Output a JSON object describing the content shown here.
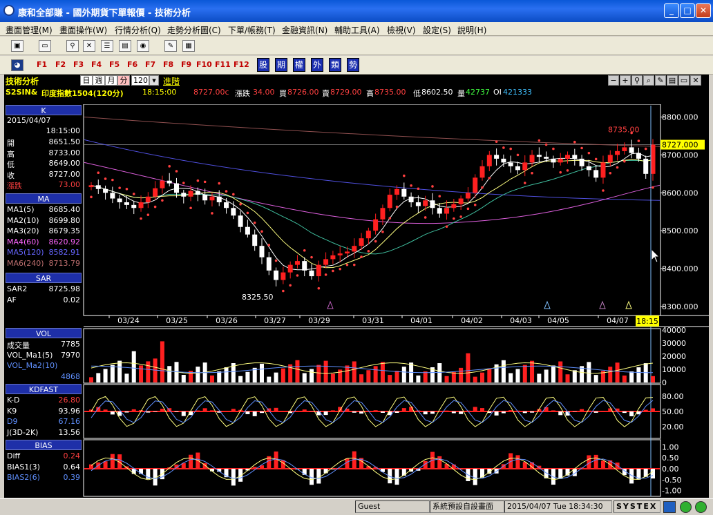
{
  "window": {
    "title": "康和全部賺 - 國外期貨下單報價 - 技術分析",
    "min_label": "_",
    "max_label": "□",
    "close_label": "✕"
  },
  "menu": [
    "畫面管理(M)",
    "畫面操作(W)",
    "行情分析(Q)",
    "走勢分析圖(C)",
    "下單/帳務(T)",
    "金融資訊(N)",
    "輔助工具(A)",
    "檢視(V)",
    "設定(S)",
    "說明(H)"
  ],
  "toolbar2": {
    "fkeys": [
      "F1",
      "F2",
      "F3",
      "F4",
      "F5",
      "F6",
      "F7",
      "F8",
      "F9",
      "F10",
      "F11",
      "F12"
    ],
    "blue": [
      "股",
      "期",
      "權",
      "外",
      "類",
      "勢"
    ]
  },
  "panel": {
    "title": "技術分析",
    "periods": [
      "日",
      "週",
      "月",
      "分"
    ],
    "active": "分",
    "interval": "120",
    "advanced": "進階"
  },
  "info": {
    "symbol": "S2SIN&",
    "name": "印度指數1504(120分)",
    "time": "18:15:00",
    "last": "8727.00c",
    "chg_label": "漲跌",
    "chg": "34.00",
    "bid_label": "買",
    "bid": "8726.00",
    "ask_label": "賣",
    "ask": "8729.00",
    "high_label": "高",
    "high": "8735.00",
    "low_label": "低",
    "low": "8602.50",
    "vol_label": "量",
    "vol": "42737",
    "oi_label": "OI",
    "oi": "421333"
  },
  "left": {
    "k_title": "K",
    "date": "2015/04/07",
    "time": "18:15:00",
    "ohlc": [
      {
        "k": "開",
        "v": "8651.50"
      },
      {
        "k": "高",
        "v": "8733.00"
      },
      {
        "k": "低",
        "v": "8649.00"
      },
      {
        "k": "收",
        "v": "8727.00"
      },
      {
        "k": "漲跌",
        "v": "73.00"
      }
    ],
    "ma_title": "MA",
    "ma": [
      {
        "k": "MA1(5)",
        "v": "8685.40",
        "c": "#ffffff"
      },
      {
        "k": "MA2(10)",
        "v": "8699.80",
        "c": "#ffffff"
      },
      {
        "k": "MA3(20)",
        "v": "8679.35",
        "c": "#ffffff"
      },
      {
        "k": "MA4(60)",
        "v": "8620.92",
        "c": "#ff66ff"
      },
      {
        "k": "MA5(120)",
        "v": "8582.91",
        "c": "#6666ff"
      },
      {
        "k": "MA6(240)",
        "v": "8713.79",
        "c": "#c07070"
      }
    ],
    "sar_title": "SAR",
    "sar": [
      {
        "k": "SAR2",
        "v": "8725.98"
      },
      {
        "k": "AF",
        "v": "0.02"
      }
    ],
    "vol_title": "VOL",
    "vol": [
      {
        "k": "成交量",
        "v": "7785"
      },
      {
        "k": "VOL_Ma1(5)",
        "v": "7970"
      },
      {
        "k": "VOL_Ma2(10)",
        "v": ""
      },
      {
        "k": "",
        "v": "4868"
      }
    ],
    "kd_title": "KDFAST",
    "kd": [
      {
        "k": "K-D",
        "v": "26.80"
      },
      {
        "k": "K9",
        "v": "93.96"
      },
      {
        "k": "D9",
        "v": "67.16"
      },
      {
        "k": "J(3D-2K)",
        "v": "13.56"
      }
    ],
    "bias_title": "BIAS",
    "bias": [
      {
        "k": "Diff",
        "v": "0.24"
      },
      {
        "k": "BIAS1(3)",
        "v": "0.64"
      },
      {
        "k": "BIAS2(6)",
        "v": "0.39"
      }
    ]
  },
  "chart_data": {
    "type": "candlestick",
    "price_ticks": [
      "8800.000",
      "8700.000",
      "8600.000",
      "8500.000",
      "8400.000",
      "8300.000"
    ],
    "price_range": [
      8280,
      8830
    ],
    "last_price": "8727.000",
    "high_label": "8735.00",
    "low_label": "8325.50",
    "dates": [
      "03/24",
      "03/25",
      "03/26",
      "03/27",
      "03/29",
      "03/31",
      "04/01",
      "04/02",
      "04/03",
      "04/05",
      "04/07"
    ],
    "cursor_time": "18:15",
    "vol_ticks": [
      "40000",
      "30000",
      "20000",
      "10000",
      "0"
    ],
    "kd_ticks": [
      "80.00",
      "50.00",
      "20.00"
    ],
    "bias_ticks": [
      "1.00",
      "0.50",
      "0.00",
      "-0.50",
      "-1.00"
    ],
    "closes": [
      8620,
      8610,
      8600,
      8585,
      8575,
      8568,
      8560,
      8575,
      8590,
      8612,
      8632,
      8625,
      8600,
      8590,
      8605,
      8595,
      8580,
      8590,
      8575,
      8560,
      8540,
      8510,
      8490,
      8460,
      8430,
      8395,
      8370,
      8390,
      8410,
      8420,
      8395,
      8380,
      8410,
      8425,
      8435,
      8440,
      8445,
      8460,
      8480,
      8500,
      8530,
      8560,
      8595,
      8610,
      8590,
      8575,
      8565,
      8580,
      8560,
      8545,
      8560,
      8570,
      8585,
      8600,
      8640,
      8670,
      8700,
      8690,
      8680,
      8670,
      8660,
      8680,
      8700,
      8695,
      8690,
      8680,
      8690,
      8700,
      8690,
      8670,
      8660,
      8640,
      8680,
      8700,
      8710,
      8720,
      8705,
      8690,
      8650,
      8727
    ]
  },
  "status": {
    "user": "Guest",
    "layout": "系統預設自設畫面",
    "datetime": "2015/04/07 Tue 18:34:30",
    "brand": "SYSTEX"
  }
}
